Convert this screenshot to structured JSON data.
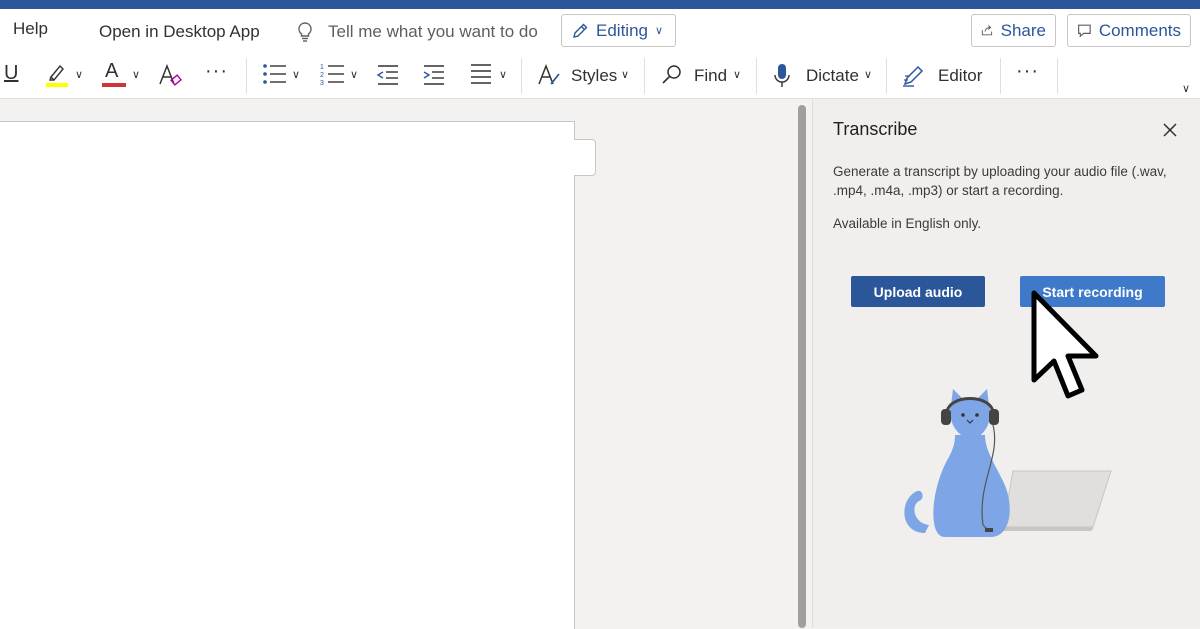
{
  "menubar": {
    "help": "Help",
    "open_desktop": "Open in Desktop App",
    "tell_me": "Tell me what you want to do",
    "editing": "Editing",
    "share": "Share",
    "comments": "Comments"
  },
  "toolbar": {
    "underline": "U",
    "styles": "Styles",
    "find": "Find",
    "dictate": "Dictate",
    "editor": "Editor",
    "font_color_letter": "A",
    "highlight_color": "#ffff00",
    "font_color": "#d13438"
  },
  "transcribe": {
    "title": "Transcribe",
    "description": "Generate a transcript by uploading your audio file (.wav, .mp4, .m4a, .mp3) or start a recording.",
    "availability": "Available in English only.",
    "upload_button": "Upload audio",
    "record_button": "Start recording"
  },
  "colors": {
    "accent": "#2b579a",
    "button_primary": "#2b579a",
    "button_hover": "#3e7ac9",
    "illustration_cat": "#7ea6e6"
  }
}
